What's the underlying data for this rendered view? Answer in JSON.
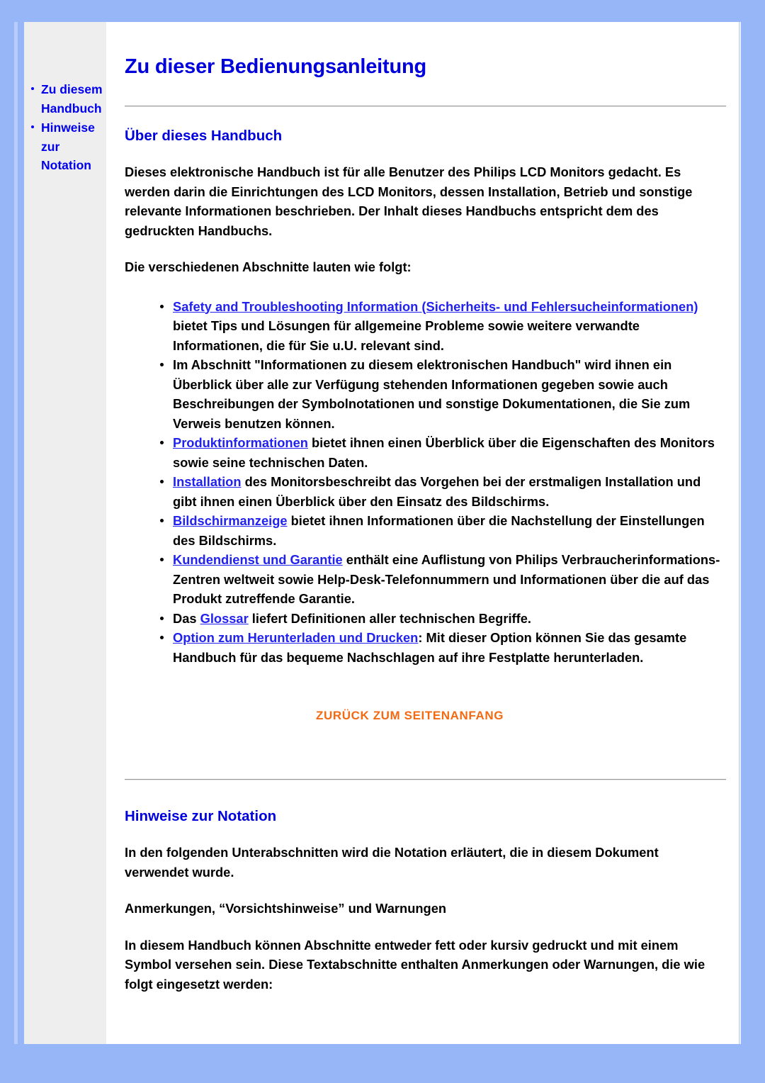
{
  "colors": {
    "page_background": "#97b6f8",
    "card_background": "#ffffff",
    "sidebar_background": "#eeeeee",
    "heading_blue": "#0000dd",
    "link_blue": "#2222ee",
    "accent_orange": "#f26a12",
    "body_text": "#000000",
    "rule_gray": "#999999"
  },
  "sidebar": {
    "items": [
      {
        "label": "Zu diesem Handbuch",
        "bullet_icon": "bullet-dot-icon"
      },
      {
        "label": "Hinweise zur Notation",
        "bullet_icon": "bullet-dot-icon"
      }
    ]
  },
  "main": {
    "page_title": "Zu dieser Bedienungsanleitung",
    "section_about": {
      "heading": "Über dieses Handbuch",
      "intro_paragraph": "Dieses elektronische Handbuch ist für alle Benutzer des Philips LCD Monitors gedacht. Es werden darin die Einrichtungen des LCD Monitors, dessen Installation, Betrieb und sonstige relevante Informationen beschrieben. Der Inhalt dieses Handbuchs entspricht dem des gedruckten Handbuchs.",
      "list_lead_in": "Die verschiedenen Abschnitte lauten wie folgt:",
      "items": [
        {
          "link_text": "Safety and Troubleshooting Information (Sicherheits- und Fehlersucheinformationen)",
          "rest_text": " bietet Tips und Lösungen für allgemeine Probleme sowie weitere verwandte Informationen, die für Sie u.U. relevant sind."
        },
        {
          "link_text": "",
          "rest_text": "Im Abschnitt \"Informationen zu diesem elektronischen Handbuch\" wird ihnen ein Überblick über alle zur Verfügung stehenden Informationen gegeben sowie auch Beschreibungen der Symbolnotationen und sonstige Dokumentationen, die Sie zum Verweis benutzen können."
        },
        {
          "link_text": "Produktinformationen",
          "rest_text": " bietet ihnen einen Überblick über die Eigenschaften des Monitors sowie seine technischen Daten."
        },
        {
          "link_text": "Installation",
          "rest_text": " des Monitorsbeschreibt das Vorgehen bei der erstmaligen Installation und gibt ihnen einen Überblick über den Einsatz des Bildschirms."
        },
        {
          "link_text": "Bildschirmanzeige",
          "rest_text": " bietet ihnen Informationen über die Nachstellung der Einstellungen des Bildschirms."
        },
        {
          "link_text": "Kundendienst und Garantie",
          "rest_text": " enthält eine Auflistung von Philips Verbraucherinformations-Zentren weltweit sowie Help-Desk-Telefonnummern und Informationen über die auf das Produkt zutreffende Garantie."
        },
        {
          "prefix_text": "Das ",
          "link_text": "Glossar",
          "rest_text": " liefert Definitionen aller technischen Begriffe."
        },
        {
          "link_text": "Option zum Herunterladen und Drucken",
          "rest_text": ": Mit dieser Option können Sie das gesamte Handbuch für das bequeme Nachschlagen auf ihre Festplatte herunterladen."
        }
      ],
      "back_to_top_label": "ZURÜCK ZUM SEITENANFANG"
    },
    "section_notation": {
      "heading": "Hinweise zur Notation",
      "paragraph_1": "In den folgenden Unterabschnitten wird die Notation erläutert, die in diesem Dokument verwendet wurde.",
      "paragraph_2": "Anmerkungen, “Vorsichtshinweise” und Warnungen",
      "paragraph_3": "In diesem Handbuch können Abschnitte entweder fett oder kursiv gedruckt und mit einem Symbol versehen sein. Diese Textabschnitte enthalten Anmerkungen oder Warnungen, die wie folgt eingesetzt werden:"
    }
  }
}
